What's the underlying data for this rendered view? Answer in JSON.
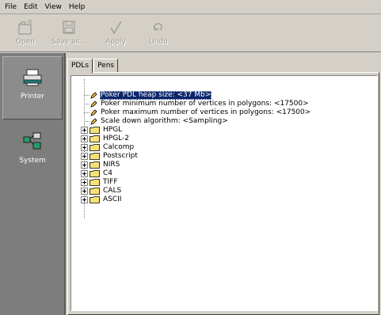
{
  "menubar": {
    "items": [
      "File",
      "Edit",
      "View",
      "Help"
    ]
  },
  "toolbar": {
    "open_label": "Open",
    "saveas_label": "Save as...",
    "apply_label": "Apply",
    "undo_label": "Undo"
  },
  "sidebar": {
    "items": [
      {
        "label": "Printer",
        "icon": "printer-icon",
        "active": true
      },
      {
        "label": "System",
        "icon": "network-icon",
        "active": false
      }
    ]
  },
  "tabs": [
    {
      "label": "PDLs",
      "selected": true
    },
    {
      "label": "Pens",
      "selected": false
    }
  ],
  "tree": {
    "settings": [
      {
        "label": "Poker PDL heap size: <37 Mb>",
        "selected": true
      },
      {
        "label": "Poker minimum number of vertices in polygons: <17500>",
        "selected": false
      },
      {
        "label": "Poker maximum number of vertices in polygons: <17500>",
        "selected": false
      },
      {
        "label": "Scale down algorithm: <Sampling>",
        "selected": false
      }
    ],
    "folders": [
      "HPGL",
      "HPGL-2",
      "Calcomp",
      "Postscript",
      "NIRS",
      "C4",
      "TIFF",
      "CALS",
      "ASCII"
    ]
  },
  "colors": {
    "background": "#d4d0c8",
    "sidebar": "#7d7d7d",
    "selection": "#0a246a",
    "folder": "#f7e17a",
    "pencil": "#e8c040"
  }
}
